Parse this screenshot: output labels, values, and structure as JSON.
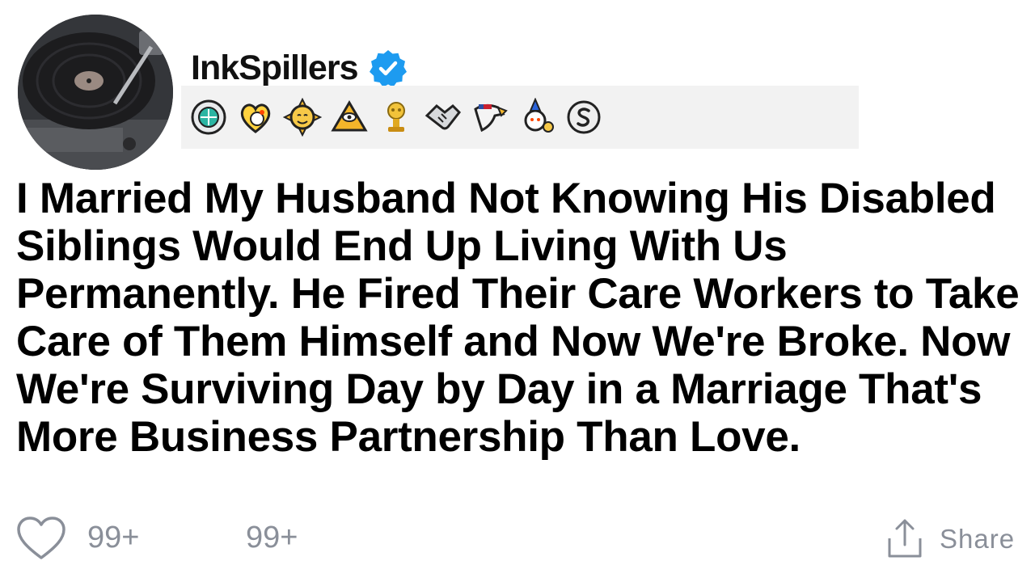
{
  "post": {
    "username": "InkSpillers",
    "verified_icon": "verified-check-icon",
    "avatar_icon": "record-player-avatar",
    "title": "I Married My Husband Not Knowing His Disabled Siblings Would End Up Living With Us Permanently. He Fired Their Care Workers to Take Care of Them Himself and Now We're Broke. Now We're Surviving Day by Day in a Marriage That's More Business Partnership Than Love.",
    "awards": [
      "wholesome-seal-icon",
      "heart-snoo-icon",
      "sun-face-icon",
      "pyramid-eye-icon",
      "gold-trophy-snoo-icon",
      "handshake-icon",
      "eagle-icon",
      "party-snoo-icon",
      "silver-s-icon"
    ]
  },
  "footer": {
    "likes_count": "99+",
    "comments_count": "99+",
    "share_label": "Share",
    "like_icon": "heart-outline-icon",
    "share_icon": "share-upload-icon"
  },
  "colors": {
    "verified_blue": "#1d9bf0",
    "muted_gray": "#8a8f99",
    "award_bar_bg": "#f2f2f2"
  }
}
